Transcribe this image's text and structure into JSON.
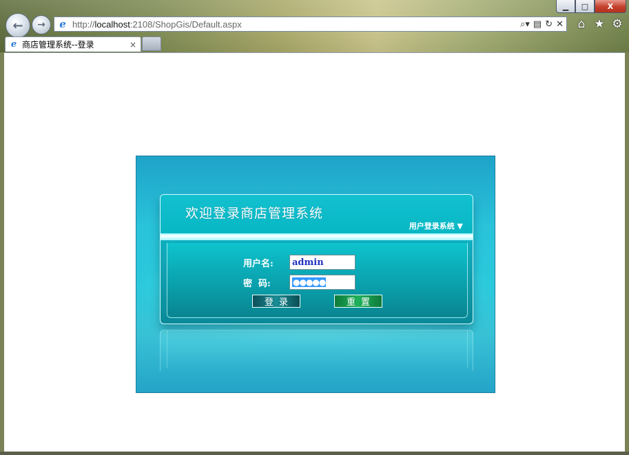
{
  "browser": {
    "url_prefix": "http://",
    "url_host": "localhost",
    "url_rest": ":2108/ShopGis/Default.aspx",
    "tab_title": "商店管理系统--登录",
    "tab_close": "×",
    "window_buttons": {
      "minimize": "▁",
      "maximize": "□",
      "close": "X"
    }
  },
  "login": {
    "title": "欢迎登录商店管理系统",
    "subtitle": "用户登录系统 ▼",
    "username_label": "用户名:",
    "password_label": "密  码:",
    "username_value": "admin",
    "password_value": "●●●●●",
    "login_button": "登录",
    "reset_button": "重置"
  },
  "colors": {
    "panel_background": "#29c3da",
    "panel_border": "#1a7fa0",
    "login_button": "#1a8c95",
    "reset_button": "#1fb15c"
  },
  "icons": [
    "back-icon",
    "forward-icon",
    "ie-icon",
    "search-icon",
    "compat-icon",
    "refresh-icon",
    "stop-icon",
    "home-icon",
    "favorites-icon",
    "tools-icon"
  ]
}
